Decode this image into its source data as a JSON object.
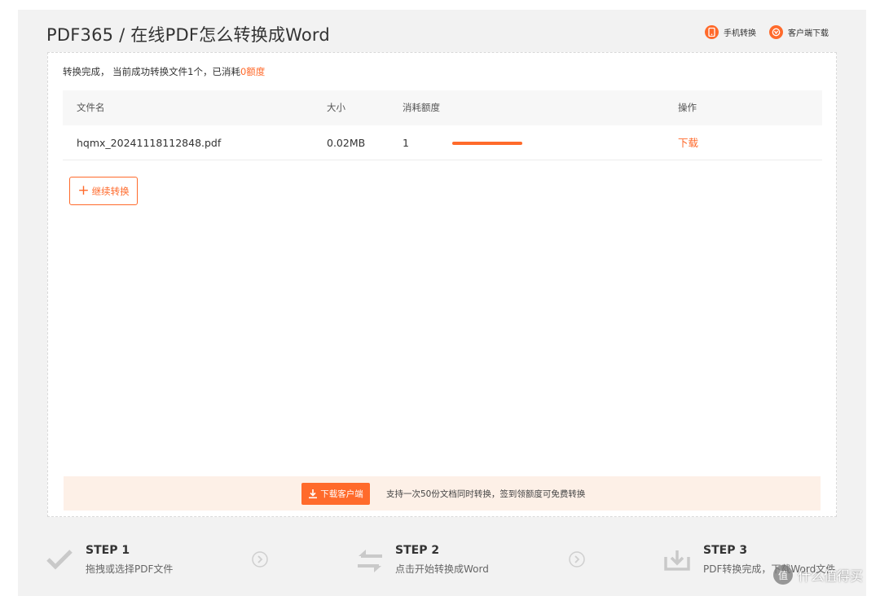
{
  "header": {
    "title": "PDF365 / 在线PDF怎么转换成Word",
    "links": [
      {
        "label": "手机转换",
        "icon": "mobile-icon"
      },
      {
        "label": "客户端下载",
        "icon": "client-download-icon"
      }
    ]
  },
  "status": {
    "prefix": "转换完成， 当前成功转换文件1个，已消耗",
    "highlight": "0额度"
  },
  "table": {
    "headers": [
      "文件名",
      "大小",
      "消耗额度",
      "操作"
    ],
    "rows": [
      {
        "filename": "hqmx_20241118112848.pdf",
        "size": "0.02MB",
        "credits": "1",
        "progress": 1.0,
        "action": "下载"
      }
    ]
  },
  "continue_button": {
    "label": "继续转换"
  },
  "promo": {
    "button": "下载客户端",
    "text": "支持一次50份文档同时转换，签到领额度可免费转换"
  },
  "steps": [
    {
      "title": "STEP 1",
      "desc": "拖拽或选择PDF文件",
      "icon": "checkmark-icon"
    },
    {
      "title": "STEP 2",
      "desc": "点击开始转换成Word",
      "icon": "convert-arrows-icon"
    },
    {
      "title": "STEP 3",
      "desc": "PDF转换完成，下载Word文件",
      "icon": "download-tray-icon"
    }
  ],
  "watermark": {
    "symbol": "值",
    "text": "什么值得买"
  },
  "colors": {
    "accent": "#ff6a2b",
    "promo_bg": "#fdf0e7",
    "frame_bg": "#f2f2f2"
  }
}
